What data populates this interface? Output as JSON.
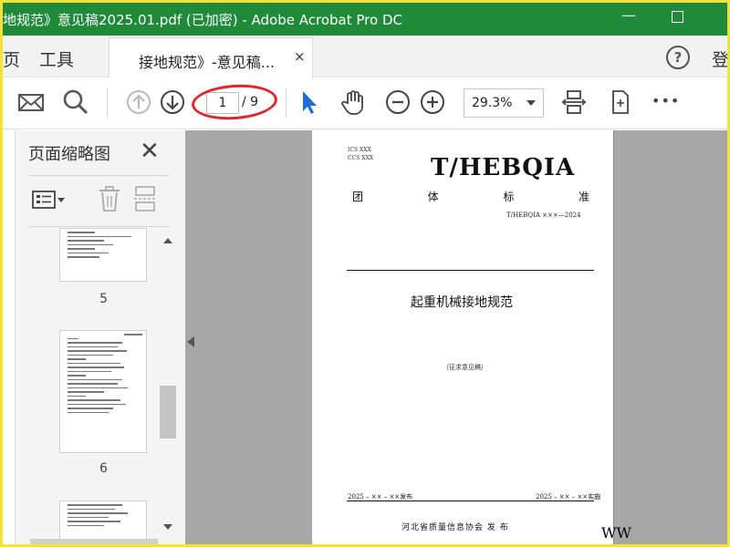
{
  "window": {
    "title": "地规范》意见稿2025.01.pdf  (已加密)  - Adobe Acrobat Pro DC",
    "minimize_label": "—",
    "maximize_label": ""
  },
  "tabs": {
    "home": "页",
    "tools": "工具",
    "document": "接地规范》-意见稿...",
    "close": "×",
    "help": "?",
    "login": "登"
  },
  "toolbar": {
    "page_current": "1",
    "page_total": "/ 9",
    "zoom": "29.3%",
    "more": "•••"
  },
  "panel": {
    "title": "页面缩略图",
    "close": "✕",
    "thumbnails": [
      {
        "number": "5"
      },
      {
        "number": "6"
      }
    ]
  },
  "document_page": {
    "ics": "ICS  XXX",
    "ccs": "CCS  XXX",
    "standard_code": "T/HEBQIA",
    "group_chars": [
      "团",
      "体",
      "标",
      "准"
    ],
    "standard_number": "T/HEBQIA  ×××—2024",
    "doc_title": "起重机械接地规范",
    "draft_note": "（征求意见稿）",
    "publish_date": "2025 – ×× – ××发布",
    "implement_date": "2025 – ×× – ××实施",
    "issuer": "河北省质量信息协会    发  布",
    "watermark": "WW"
  },
  "colors": {
    "titlebar": "#1e8a3a",
    "highlight_ring": "#e0262a",
    "select_tool": "#1d6fd6",
    "viewer_bg": "#a7a7a7"
  }
}
